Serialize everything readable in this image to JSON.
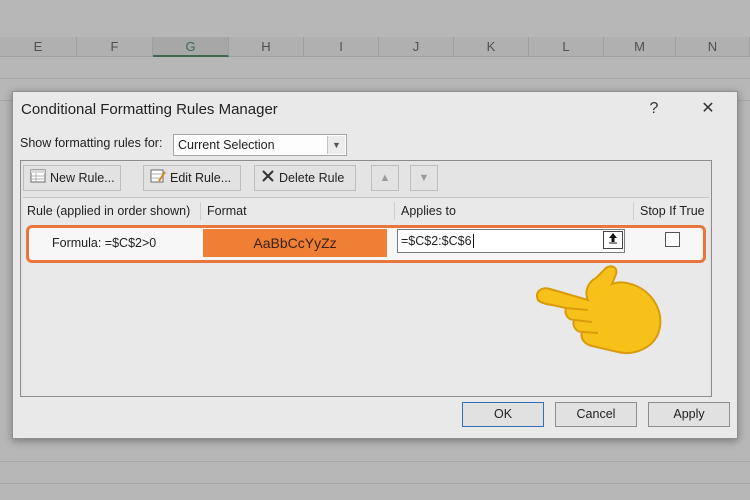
{
  "spreadsheet": {
    "columns": [
      "E",
      "F",
      "G",
      "H",
      "I",
      "J",
      "K",
      "L",
      "M",
      "N"
    ],
    "active_column": "G"
  },
  "dialog": {
    "title": "Conditional Formatting Rules Manager",
    "help_label": "?",
    "close_label": "✕",
    "show_rules_label": "Show formatting rules for:",
    "show_rules_value": "Current Selection",
    "toolbar": {
      "new_rule": "New Rule...",
      "edit_rule": "Edit Rule...",
      "delete_rule": "Delete Rule"
    },
    "headers": {
      "rule": "Rule (applied in order shown)",
      "format": "Format",
      "applies_to": "Applies to",
      "stop_if_true": "Stop If True"
    },
    "rules": [
      {
        "rule": "Formula: =$C$2>0",
        "format_preview": "AaBbCcYyZz",
        "applies_to": "=$C$2:$C$6",
        "stop_if_true": false
      }
    ],
    "buttons": {
      "ok": "OK",
      "cancel": "Cancel",
      "apply": "Apply"
    }
  },
  "colors": {
    "highlight": "#e8763c",
    "format_fill": "#ef7f35",
    "excel_green": "#217346"
  },
  "icons": [
    "new-rule-icon",
    "edit-rule-icon",
    "delete-rule-icon",
    "move-up-icon",
    "move-down-icon",
    "collapse-dialog-icon",
    "pointing-hand-icon"
  ]
}
